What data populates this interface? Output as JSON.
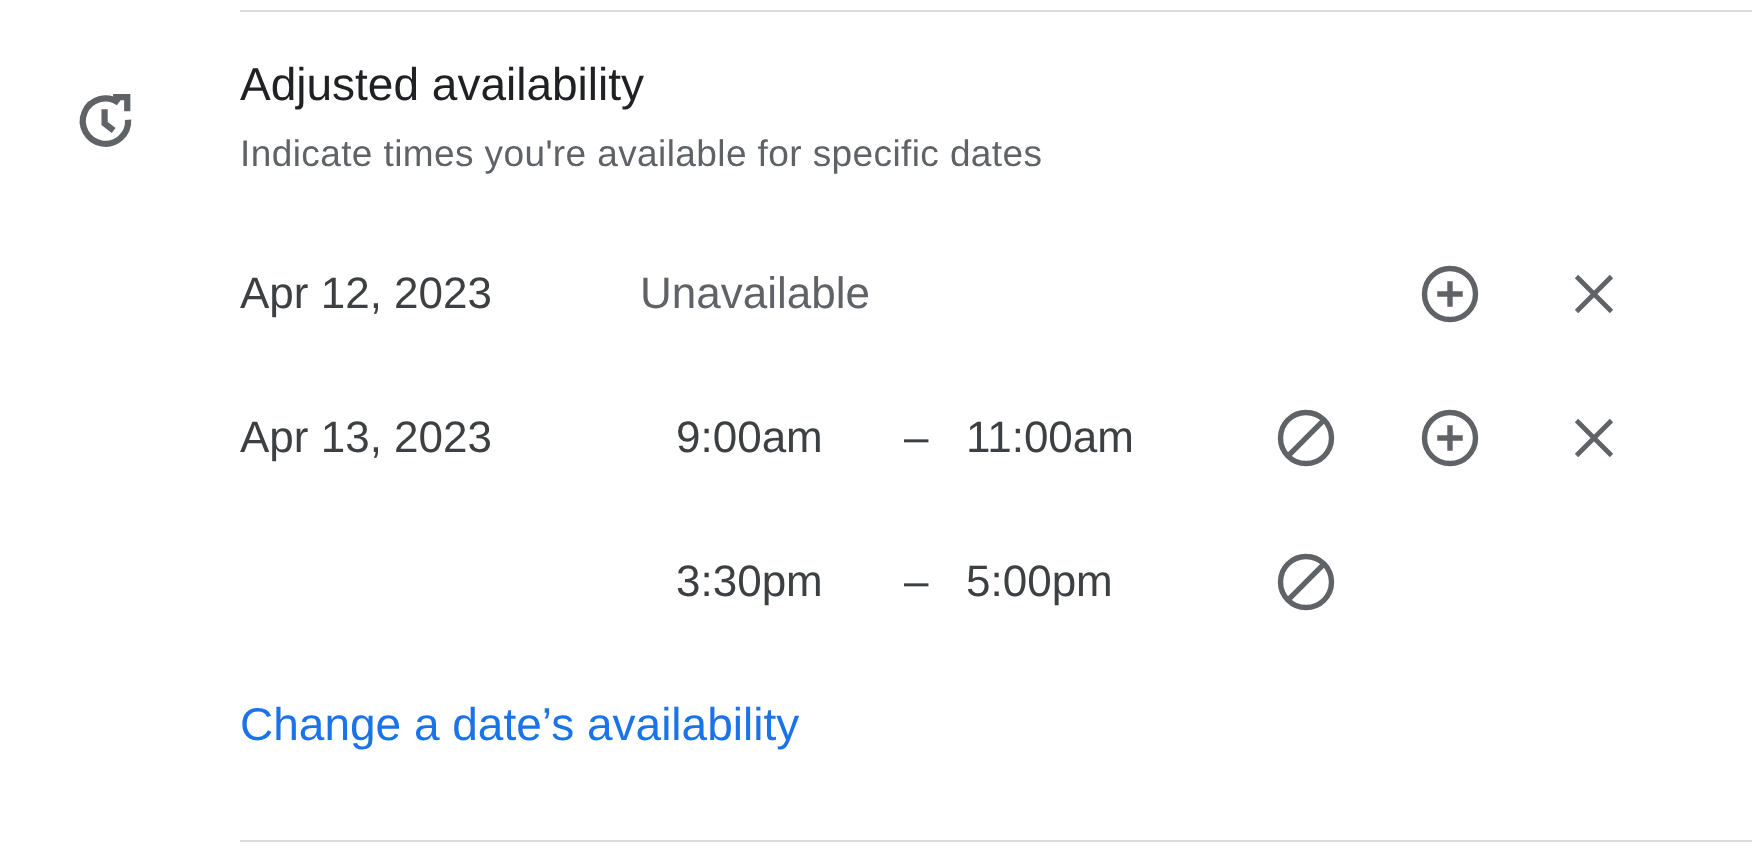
{
  "section": {
    "title": "Adjusted availability",
    "subtitle": "Indicate times you're available for specific dates"
  },
  "dates": [
    {
      "date": "Apr 12, 2023",
      "kind": "unavailable",
      "status": "Unavailable"
    },
    {
      "date": "Apr 13, 2023",
      "kind": "hours",
      "slots": [
        {
          "start": "9:00am",
          "separator": "–",
          "end": "11:00am"
        },
        {
          "start": "3:30pm",
          "separator": "–",
          "end": "5:00pm"
        }
      ]
    }
  ],
  "link": "Change a date’s availability"
}
